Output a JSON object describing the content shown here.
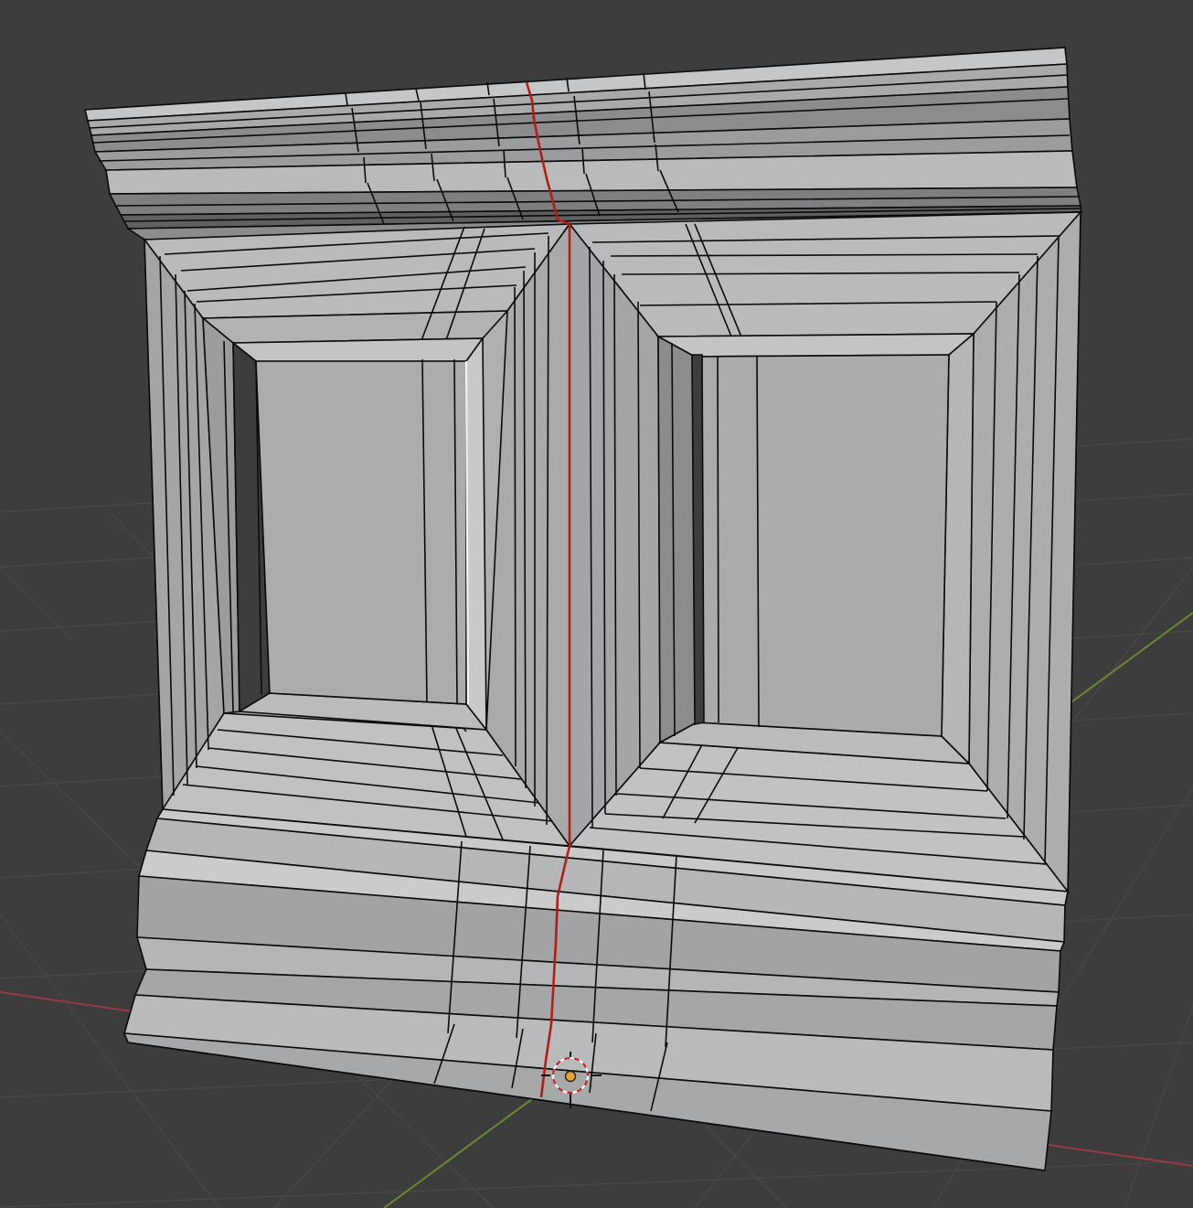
{
  "viewport": {
    "background": "#3d3d3d",
    "grid_color": "#4a4a4a",
    "x_axis_color": "#9a3a45",
    "y_axis_color": "#6a8a32"
  },
  "mesh": {
    "object": "wall-panel-mesh",
    "face_light": "#b4b6b7",
    "face_mid": "#a4a6a7",
    "face_dark": "#858788",
    "face_shadow": "#6a6b6c",
    "edge_color": "#0a0a0a",
    "seam_color": "#b01e14",
    "panel_count": 2
  },
  "gizmos": {
    "origin": "object-origin-icon",
    "cursor": "3d-cursor-icon",
    "origin_color": "#f0a030"
  }
}
